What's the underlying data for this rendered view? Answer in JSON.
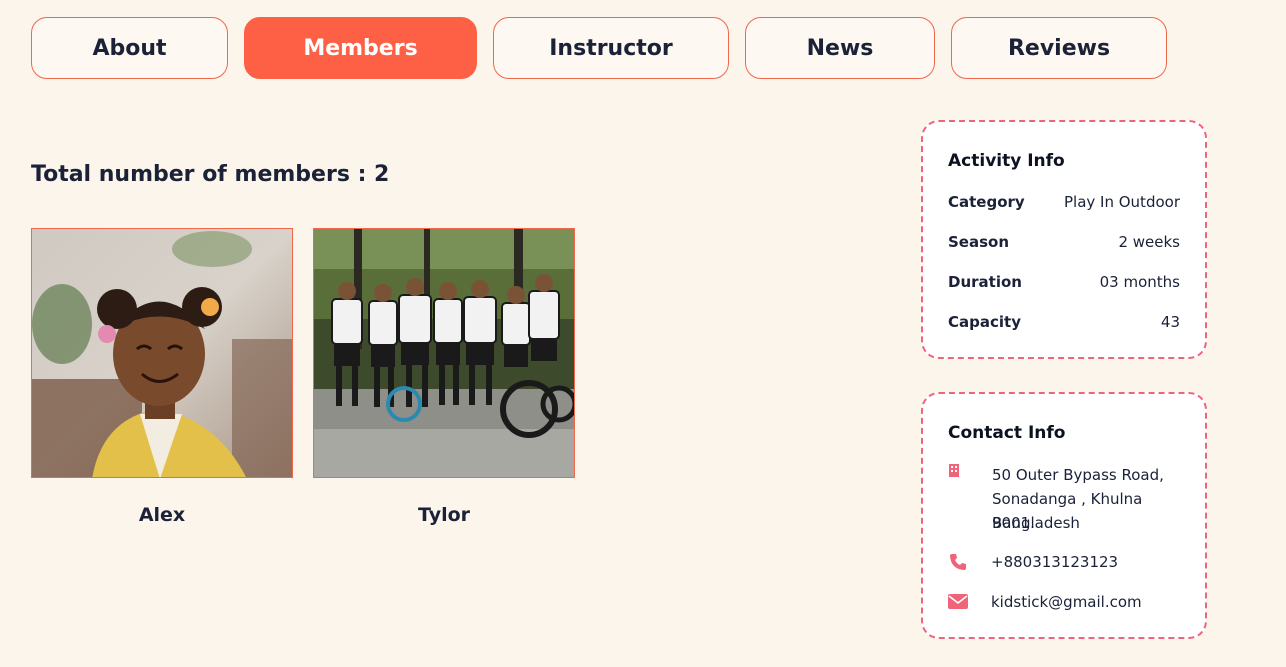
{
  "tabs": [
    {
      "label": "About",
      "active": false
    },
    {
      "label": "Members",
      "active": true
    },
    {
      "label": "Instructor",
      "active": false
    },
    {
      "label": "News",
      "active": false
    },
    {
      "label": "Reviews",
      "active": false
    }
  ],
  "members": {
    "total_label": "Total number of members : 2",
    "items": [
      {
        "name": "Alex",
        "photo": "child-portrait"
      },
      {
        "name": "Tylor",
        "photo": "cycling-group"
      }
    ]
  },
  "activity_info": {
    "title": "Activity Info",
    "rows": [
      {
        "key": "Category",
        "value": "Play In Outdoor"
      },
      {
        "key": "Season",
        "value": "2 weeks"
      },
      {
        "key": "Duration",
        "value": "03 months"
      },
      {
        "key": "Capacity",
        "value": "43"
      }
    ]
  },
  "contact_info": {
    "title": "Contact Info",
    "address_line1": "50 Outer Bypass Road,",
    "address_line2": "Sonadanga , Khulna 9001.",
    "address_line3": "Bangladesh",
    "phone": "+880313123123",
    "email": "kidstick@gmail.com",
    "icons": {
      "address": "building-icon",
      "phone": "phone-icon",
      "email": "envelope-icon"
    }
  },
  "colors": {
    "accent": "#fd6045",
    "background": "#fbf5ec",
    "card_border": "#f0647a",
    "text": "#1b2238"
  }
}
